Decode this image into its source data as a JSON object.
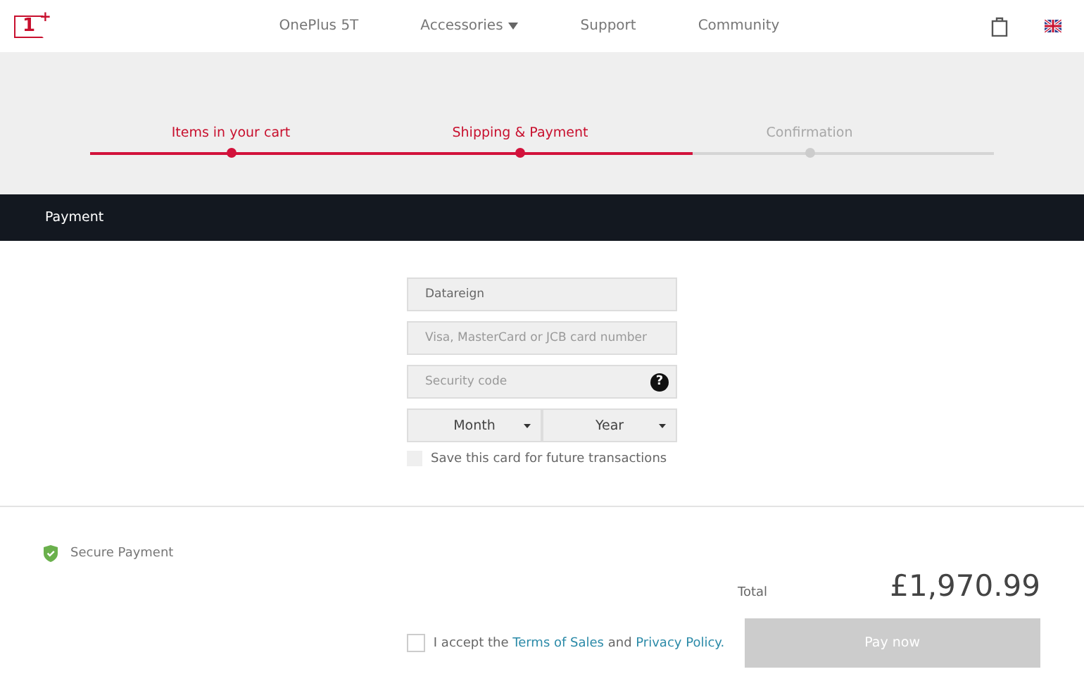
{
  "logo": {
    "mark": "1",
    "plus": "+"
  },
  "nav": [
    {
      "label": "OnePlus 5T",
      "dropdown": false
    },
    {
      "label": "Accessories",
      "dropdown": true
    },
    {
      "label": "Support",
      "dropdown": false
    },
    {
      "label": "Community",
      "dropdown": false
    }
  ],
  "progress": {
    "level": 0.667,
    "steps": [
      {
        "label": "Items in your cart",
        "reached": true
      },
      {
        "label": "Shipping & Payment",
        "reached": true
      },
      {
        "label": "Confirmation",
        "reached": false
      }
    ]
  },
  "section_title": "Payment",
  "form": {
    "name": {
      "value": "Datareign"
    },
    "card_number": {
      "placeholder": "Visa, MasterCard or JCB card number"
    },
    "security_code": {
      "placeholder": "Security code",
      "help": "?"
    },
    "expiry": [
      {
        "label": "Month"
      },
      {
        "label": "Year"
      }
    ],
    "save_card": {
      "label": "Save this card for future transactions",
      "checked": false,
      "disabled": true
    }
  },
  "secure_label": "Secure Payment",
  "total": {
    "label": "Total",
    "amount": "£1,970.99"
  },
  "terms": {
    "checked": false,
    "before": "I accept the",
    "link1": "Terms of Sales",
    "middle": "and",
    "link2": "Privacy Policy."
  },
  "pay_button": {
    "label": "Pay now",
    "disabled": true
  }
}
